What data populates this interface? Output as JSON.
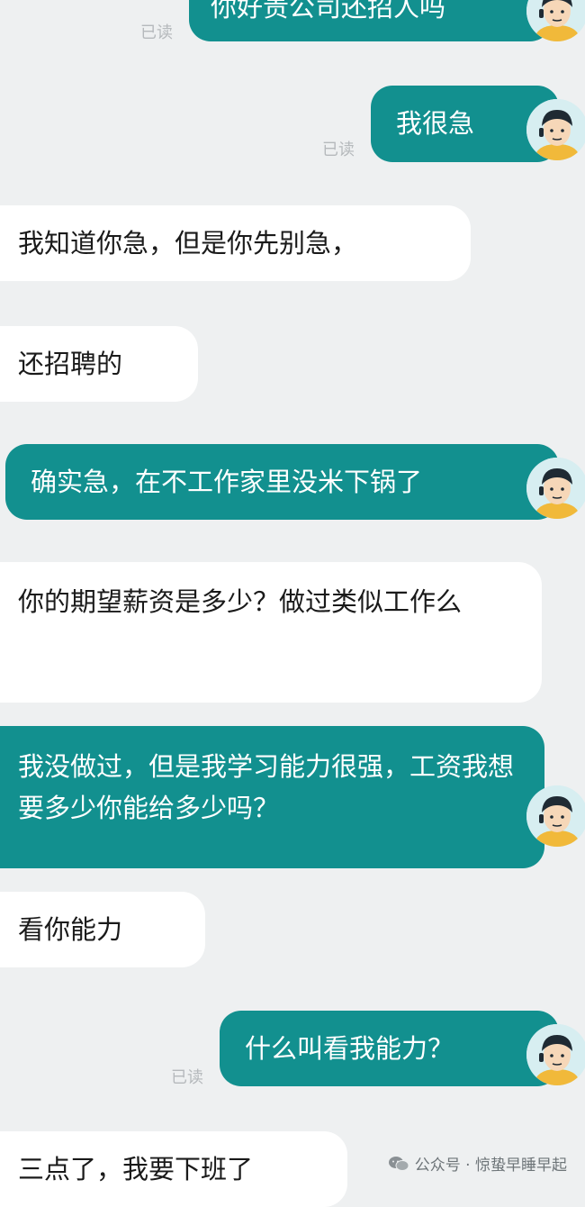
{
  "chat": {
    "read_label": "已读",
    "messages": [
      {
        "side": "out",
        "text": "你好贵公司还招人吗",
        "read": true
      },
      {
        "side": "out",
        "text": "我很急",
        "read": true
      },
      {
        "side": "in",
        "text": "我知道你急，但是你先别急，"
      },
      {
        "side": "in",
        "text": "还招聘的"
      },
      {
        "side": "out",
        "text": "确实急，在不工作家里没米下锅了",
        "read": false
      },
      {
        "side": "in",
        "text": "你的期望薪资是多少？做过类似工作么"
      },
      {
        "side": "out",
        "text": "我没做过，但是我学习能力很强，工资我想要多少你能给多少吗？",
        "read": false
      },
      {
        "side": "in",
        "text": "看你能力"
      },
      {
        "side": "out",
        "text": "什么叫看我能力？",
        "read": true
      },
      {
        "side": "in",
        "text": "三点了，我要下班了"
      }
    ]
  },
  "watermark": {
    "text": "公众号 · 惊蛰早睡早起",
    "icon": "wechat-icon"
  },
  "colors": {
    "background": "#eef0f1",
    "outgoing_bubble": "#12908f",
    "incoming_bubble": "#ffffff"
  }
}
